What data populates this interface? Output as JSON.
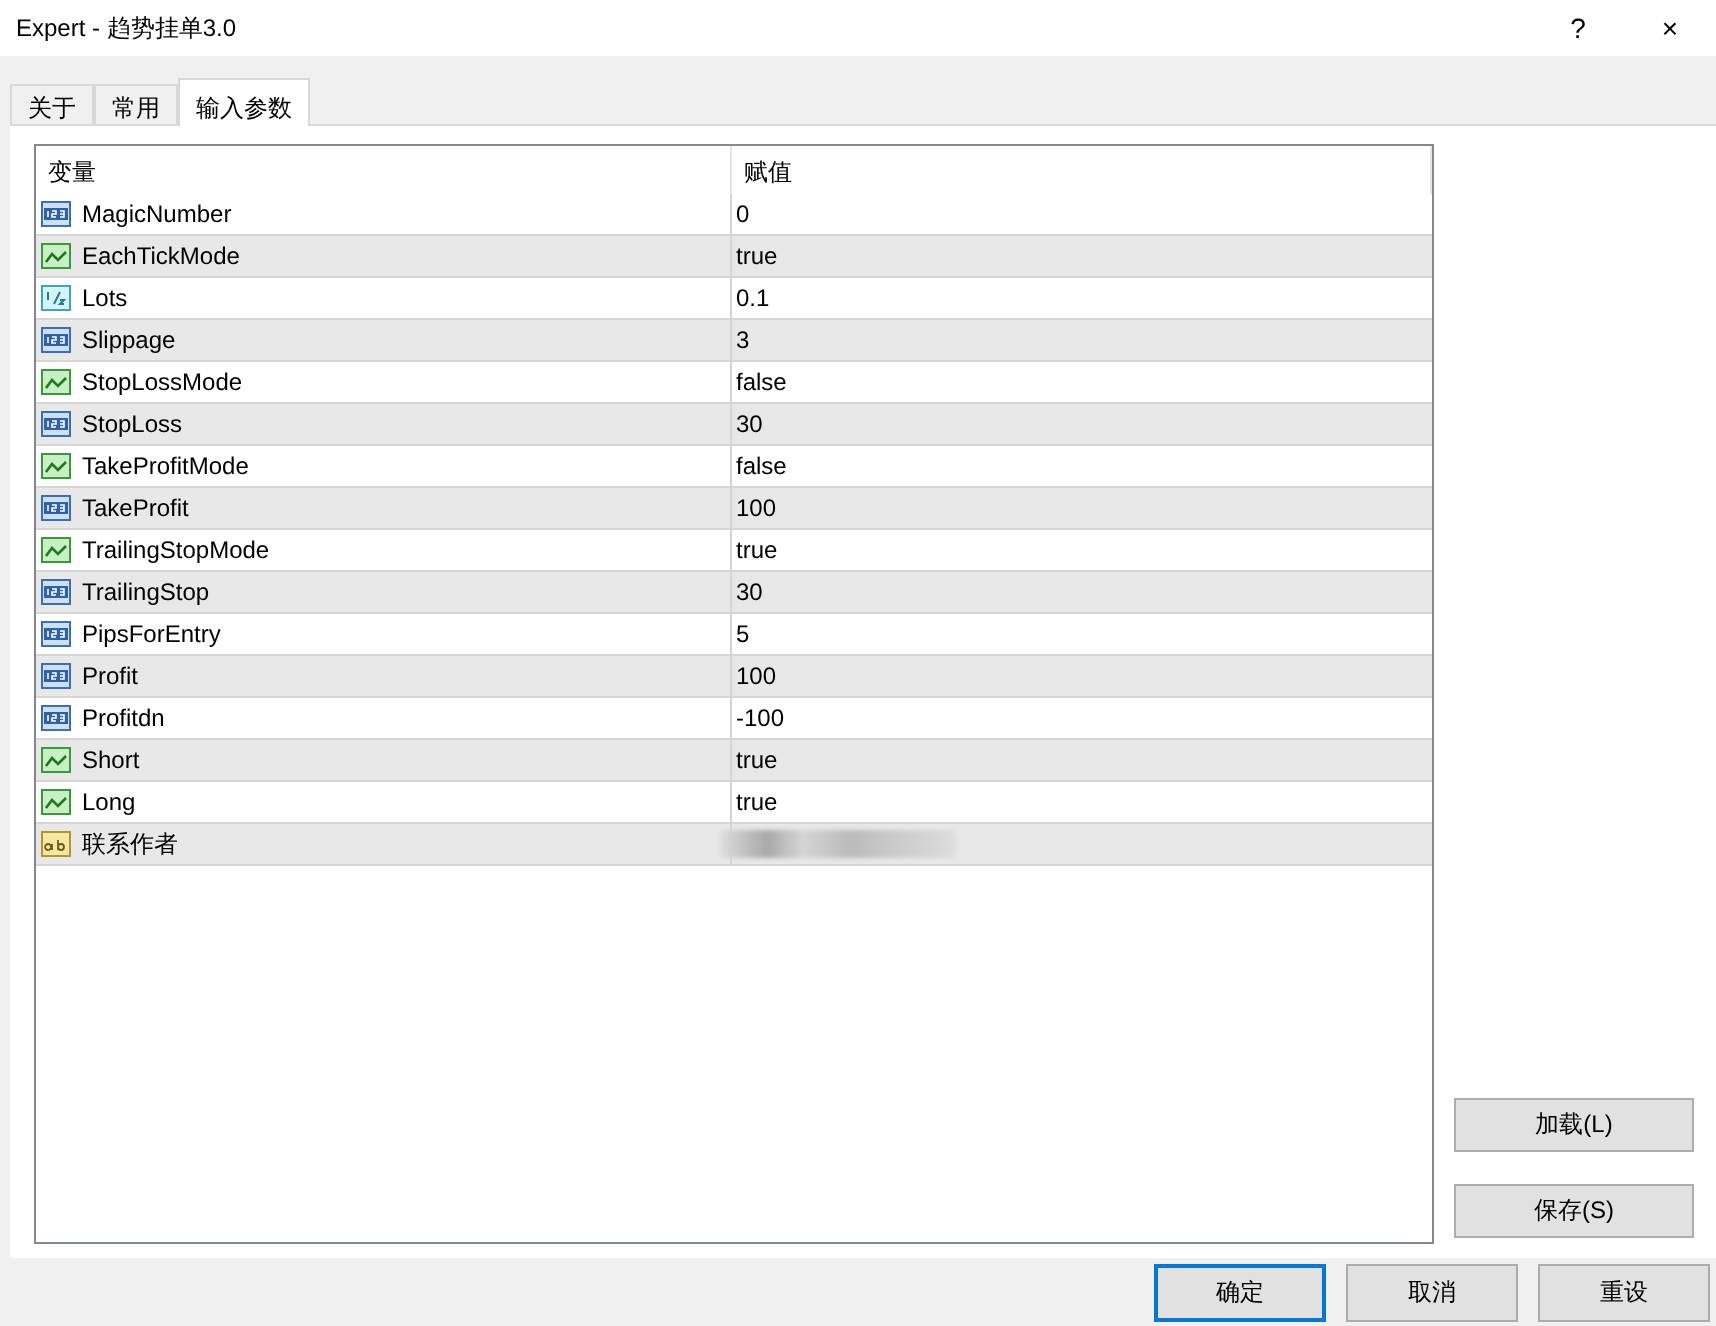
{
  "window": {
    "title": "Expert - 趋势挂单3.0",
    "help": "?",
    "close": "×"
  },
  "tabs": [
    {
      "label": "关于",
      "selected": false
    },
    {
      "label": "常用",
      "selected": false
    },
    {
      "label": "输入参数",
      "selected": true
    }
  ],
  "table": {
    "columns": [
      "变量",
      "赋值"
    ],
    "rows": [
      {
        "kind": "int",
        "name": "MagicNumber",
        "value": "0"
      },
      {
        "kind": "bool",
        "name": "EachTickMode",
        "value": "true"
      },
      {
        "kind": "double",
        "name": "Lots",
        "value": "0.1"
      },
      {
        "kind": "int",
        "name": "Slippage",
        "value": "3"
      },
      {
        "kind": "bool",
        "name": "StopLossMode",
        "value": "false"
      },
      {
        "kind": "int",
        "name": "StopLoss",
        "value": "30"
      },
      {
        "kind": "bool",
        "name": "TakeProfitMode",
        "value": "false"
      },
      {
        "kind": "int",
        "name": "TakeProfit",
        "value": "100"
      },
      {
        "kind": "bool",
        "name": "TrailingStopMode",
        "value": "true"
      },
      {
        "kind": "int",
        "name": "TrailingStop",
        "value": "30"
      },
      {
        "kind": "int",
        "name": "PipsForEntry",
        "value": "5"
      },
      {
        "kind": "int",
        "name": "Profit",
        "value": "100"
      },
      {
        "kind": "int",
        "name": "Profitdn",
        "value": "-100"
      },
      {
        "kind": "bool",
        "name": "Short",
        "value": "true"
      },
      {
        "kind": "bool",
        "name": "Long",
        "value": "true"
      },
      {
        "kind": "string",
        "name": "联系作者",
        "redacted": true
      }
    ]
  },
  "side_buttons": [
    "加载(L)",
    "保存(S)"
  ],
  "dialog_buttons": [
    {
      "label": "确定",
      "focused": true
    },
    {
      "label": "取消",
      "focused": false
    },
    {
      "label": "重设",
      "focused": false
    }
  ]
}
